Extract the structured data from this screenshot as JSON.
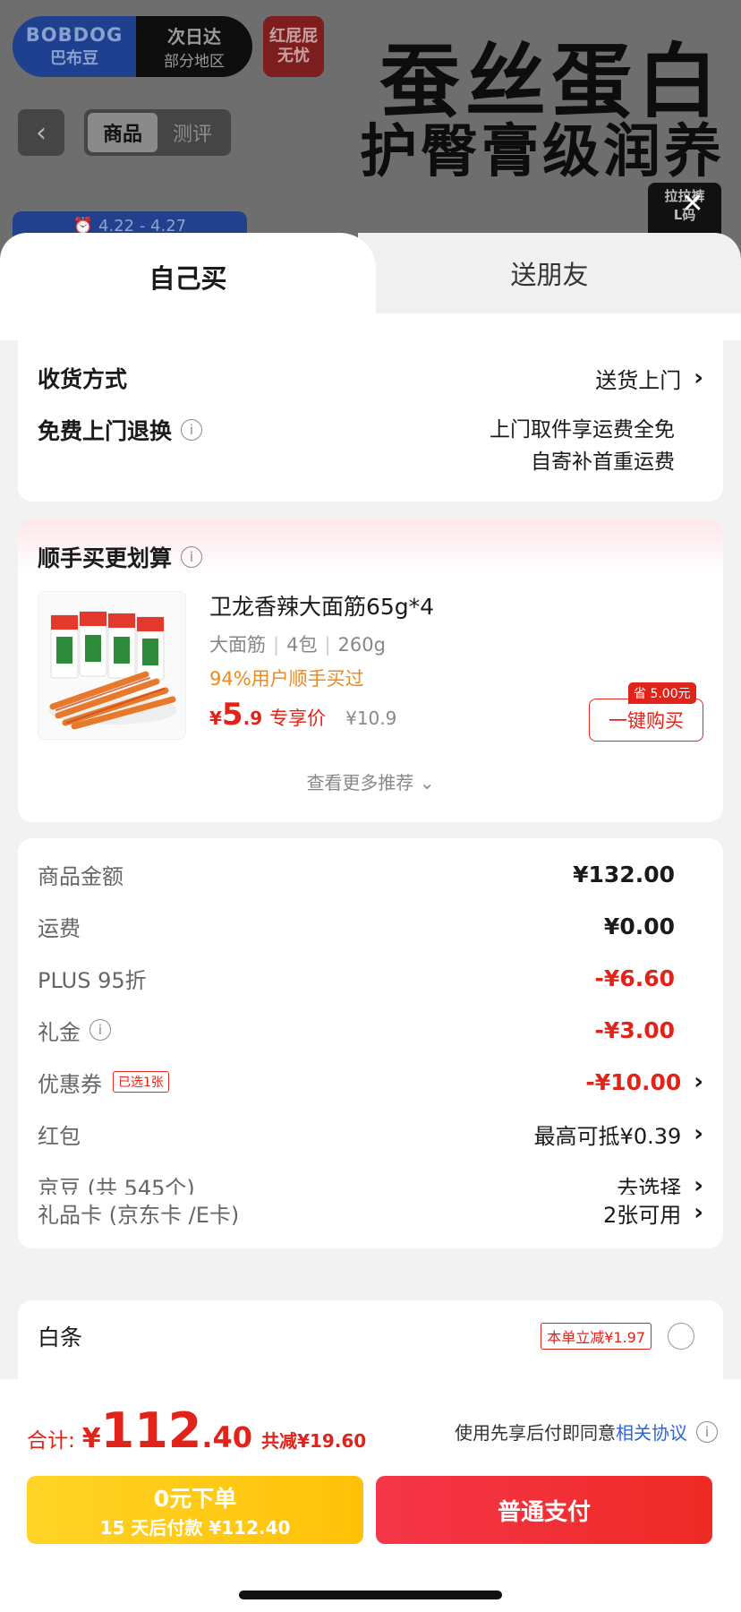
{
  "background": {
    "hero_line1": "蚕丝蛋白",
    "hero_line2": "护臀膏级润养",
    "brand_name": "BOBDOG",
    "brand_cn": "巴布豆",
    "delivery_line1": "次日达",
    "delivery_line2": "部分地区",
    "red_badge_line1": "红屁屁",
    "red_badge_line2": "无忧",
    "tab_product": "商品",
    "tab_review": "测评",
    "date_range": "4.22 - 4.27",
    "size_line1": "拉拉裤",
    "size_line2": "L码"
  },
  "tabs": {
    "self": "自己买",
    "friend": "送朋友"
  },
  "delivery": {
    "method_label": "收货方式",
    "method_value": "送货上门",
    "return_label": "免费上门退换",
    "return_line1": "上门取件享运费全免",
    "return_line2": "自寄补首重运费"
  },
  "upsell": {
    "title": "顺手买更划算",
    "product_title": "卫龙香辣大面筋65g*4",
    "spec1": "大面筋",
    "spec2": "4包",
    "spec3": "260g",
    "hint": "94%用户顺手买过",
    "price_currency": "¥",
    "price_int": "5",
    "price_dec": ".9",
    "price_tag": "专享价",
    "orig_price": "¥10.9",
    "save_tag": "省 5.00元",
    "buy_label": "一键购买",
    "more_label": "查看更多推荐"
  },
  "summary": {
    "goods_label": "商品金额",
    "goods_value": "¥132.00",
    "shipping_label": "运费",
    "shipping_value": "¥0.00",
    "plus_label": "PLUS 95折",
    "plus_value": "-¥6.60",
    "gift_label": "礼金",
    "gift_value": "-¥3.00",
    "coupon_label": "优惠券",
    "coupon_tag": "已选1张",
    "coupon_value": "-¥10.00",
    "redpacket_label": "红包",
    "redpacket_value": "最高可抵¥0.39",
    "jingdou_label": "京豆 (共 545个)",
    "jingdou_value": "去选择",
    "giftcard_label": "礼品卡 (京东卡 /E卡)",
    "giftcard_value": "2张可用"
  },
  "baitiao": {
    "label": "白条",
    "tag": "本单立减¥1.97"
  },
  "footer": {
    "total_label": "合计:",
    "total_currency": "¥",
    "total_int": "112",
    "total_dec": ".40",
    "total_save": "共减¥19.60",
    "agree_text": "使用先享后付即同意",
    "agree_link": "相关协议",
    "zero_line1": "0元下单",
    "zero_line2": "15 天后付款 ¥112.40",
    "pay_label": "普通支付"
  }
}
